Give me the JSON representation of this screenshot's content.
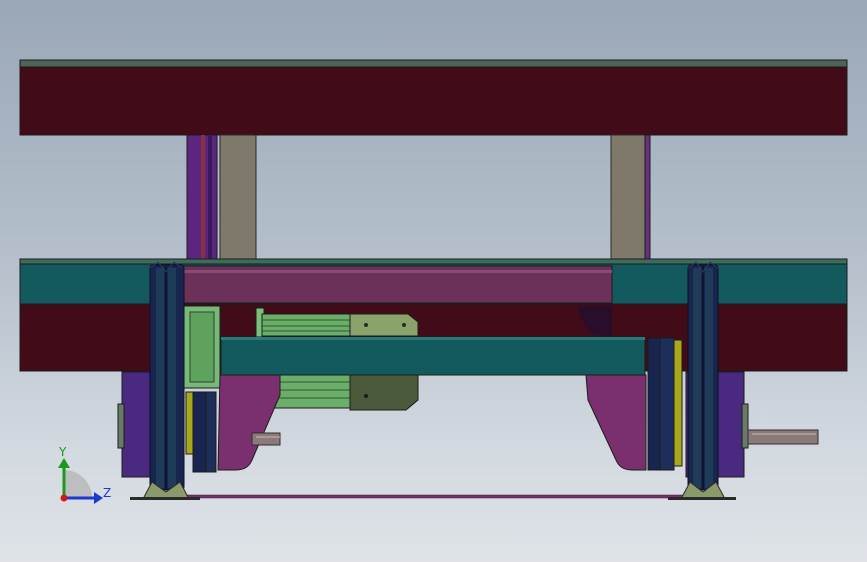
{
  "triad": {
    "y_label": "Y",
    "z_label": "Z"
  },
  "colors": {
    "maroon": "#410b18",
    "teal": "#125a5e",
    "taupe": "#7d786a",
    "purple": "#5a2a7a",
    "magenta": "#7a2f6e",
    "dark_blue": "#16244d",
    "olive_yellow": "#9a9a1a",
    "green": "#5a9a4a",
    "gray_rod": "#8a7a7a"
  }
}
